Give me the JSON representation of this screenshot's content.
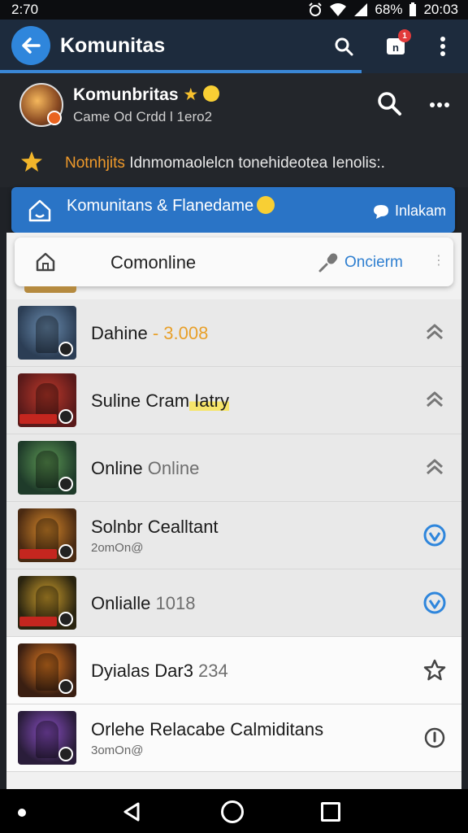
{
  "status_bar": {
    "left_time": "2:70",
    "battery": "68%",
    "clock": "20:03"
  },
  "app_bar": {
    "title": "Komunitas",
    "notification_count": "1"
  },
  "community": {
    "name": "Komunbritas",
    "subtitle": "Came Od Crdd l 1ero2"
  },
  "announcement": {
    "highlight": "Notnhjits",
    "text": "Idnmomaolelcn tonehideotea Ienolis:."
  },
  "banner": {
    "title": "Komunitans & Flanedame",
    "action": "Inlakam"
  },
  "search_row": {
    "label": "Comonline",
    "action": "Oncierm"
  },
  "rows": [
    {
      "title": "Dahine",
      "extra": "- 3.008",
      "subtitle": "",
      "action_icon": "chevron-up-icon",
      "bg": "gray",
      "thumb": [
        "#2c3e55",
        "#6b8db0"
      ]
    },
    {
      "title": "Suline Cram",
      "extra": "Iatry",
      "subtitle": "",
      "action_icon": "chevron-up-icon",
      "bg": "gray",
      "thumb": [
        "#5a1a1a",
        "#c0392b"
      ]
    },
    {
      "title": "Online",
      "extra": "Online",
      "subtitle": "",
      "action_icon": "chevron-up-icon",
      "bg": "gray",
      "thumb": [
        "#1f3b2a",
        "#5e9a55"
      ]
    },
    {
      "title": "Solnbr Cealltant",
      "extra": "",
      "subtitle": "2omOn@",
      "action_icon": "check-circle-icon",
      "bg": "gray",
      "thumb": [
        "#4a2a12",
        "#d98a2b"
      ]
    },
    {
      "title": "Onlialle",
      "extra": "1018",
      "subtitle": "",
      "action_icon": "check-circle-icon",
      "bg": "gray",
      "thumb": [
        "#2a2410",
        "#d1a12e"
      ]
    },
    {
      "title": "Dyialas Dar3",
      "extra": "234",
      "subtitle": "",
      "action_icon": "star-outline-icon",
      "bg": "light",
      "thumb": [
        "#3a1f12",
        "#e07a22"
      ]
    },
    {
      "title": "Orlehe Relacabe Calmiditans",
      "extra": "",
      "subtitle": "3omOn@",
      "action_icon": "info-circle-icon",
      "bg": "light",
      "thumb": [
        "#2a1d3a",
        "#8a4fc4"
      ]
    }
  ],
  "colors": {
    "accent_blue": "#2a74c6",
    "check_blue": "#2f86dc"
  }
}
